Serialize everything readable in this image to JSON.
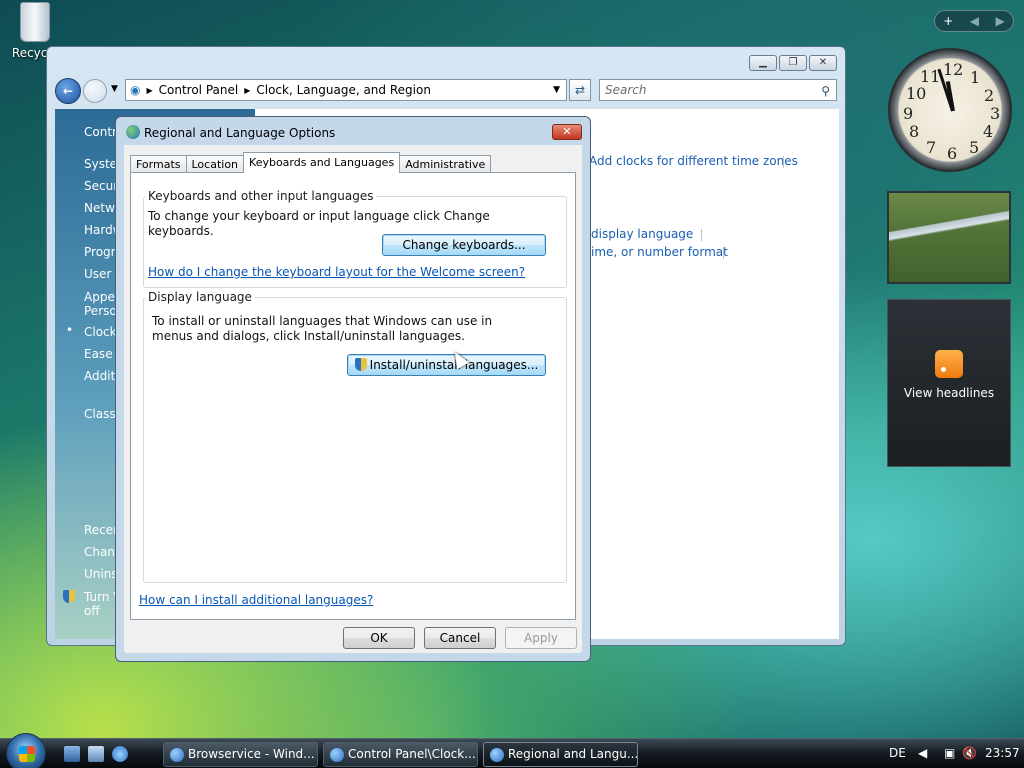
{
  "desktop": {
    "recycle_label": "Recycle"
  },
  "gadgets": {
    "toolbar_plus": "+",
    "toolbar_prev": "◀",
    "toolbar_next": "▶",
    "clock_numbers": [
      "12",
      "1",
      "2",
      "3",
      "4",
      "5",
      "6",
      "7",
      "8",
      "9",
      "10",
      "11"
    ],
    "feed_label": "View headlines"
  },
  "explorer": {
    "breadcrumb": [
      "Control Panel",
      "Clock, Language, and Region"
    ],
    "search_placeholder": "Search",
    "left_pane": [
      "Contro",
      "Syster",
      "Securi",
      "Netwo",
      "Hardw",
      "Progra",
      "User A",
      "Appea",
      "Perso",
      "Clock",
      "Ease o",
      "Additi",
      "Classi",
      "Recer",
      "Chang",
      "Uninst",
      "Turn V",
      "off"
    ],
    "content_links": [
      "Add clocks for different time zones",
      "display language",
      "ime, or number format"
    ]
  },
  "dialog": {
    "title": "Regional and Language Options",
    "close_label": "✕",
    "tabs": [
      "Formats",
      "Location",
      "Keyboards and Languages",
      "Administrative"
    ],
    "keyboards_group": {
      "label": "Keyboards and other input languages",
      "text": "To change your keyboard or input language click Change keyboards.",
      "button": "Change keyboards...",
      "help_link": "How do I change the keyboard layout for the Welcome screen?"
    },
    "display_group": {
      "label": "Display language",
      "text": "To install or uninstall languages that Windows can use in menus and dialogs, click Install/uninstall languages.",
      "button": "Install/uninstall languages..."
    },
    "bottom_link": "How can I install additional languages?",
    "buttons": {
      "ok": "OK",
      "cancel": "Cancel",
      "apply": "Apply"
    }
  },
  "taskbar": {
    "tasks": [
      "Browservice - Wind...",
      "Control Panel\\Clock...",
      "Regional and Langu..."
    ],
    "language": "DE",
    "time": "23:57"
  }
}
